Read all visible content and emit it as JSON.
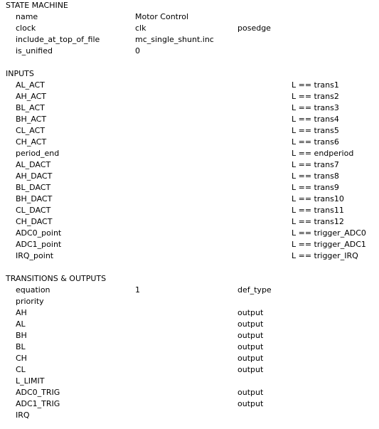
{
  "document": {
    "background_color": "#ffffff",
    "text_color": "#000000"
  },
  "sections": [
    {
      "id": "state-machine",
      "header": "STATE MACHINE",
      "rows": [
        {
          "label": "name",
          "value": "Motor Control",
          "extra": "",
          "condition": ""
        },
        {
          "label": "clock",
          "value": "clk",
          "extra": "posedge",
          "condition": ""
        },
        {
          "label": "include_at_top_of_file",
          "value": "mc_single_shunt.inc",
          "extra": "",
          "condition": ""
        },
        {
          "label": "is_unified",
          "value": "0",
          "extra": "",
          "condition": ""
        }
      ]
    },
    {
      "id": "inputs",
      "header": "INPUTS",
      "rows": [
        {
          "label": "AL_ACT",
          "value": "",
          "extra": "",
          "condition": "L == trans1"
        },
        {
          "label": "AH_ACT",
          "value": "",
          "extra": "",
          "condition": "L == trans2"
        },
        {
          "label": "BL_ACT",
          "value": "",
          "extra": "",
          "condition": "L == trans3"
        },
        {
          "label": "BH_ACT",
          "value": "",
          "extra": "",
          "condition": "L == trans4"
        },
        {
          "label": "CL_ACT",
          "value": "",
          "extra": "",
          "condition": "L == trans5"
        },
        {
          "label": "CH_ACT",
          "value": "",
          "extra": "",
          "condition": "L == trans6"
        },
        {
          "label": "period_end",
          "value": "",
          "extra": "",
          "condition": "L == endperiod"
        },
        {
          "label": "AL_DACT",
          "value": "",
          "extra": "",
          "condition": "L == trans7"
        },
        {
          "label": "AH_DACT",
          "value": "",
          "extra": "",
          "condition": "L == trans8"
        },
        {
          "label": "BL_DACT",
          "value": "",
          "extra": "",
          "condition": "L == trans9"
        },
        {
          "label": "BH_DACT",
          "value": "",
          "extra": "",
          "condition": "L == trans10"
        },
        {
          "label": "CL_DACT",
          "value": "",
          "extra": "",
          "condition": "L == trans11"
        },
        {
          "label": "CH_DACT",
          "value": "",
          "extra": "",
          "condition": "L == trans12"
        },
        {
          "label": "ADC0_point",
          "value": "",
          "extra": "",
          "condition": "L == trigger_ADC0"
        },
        {
          "label": "ADC1_point",
          "value": "",
          "extra": "",
          "condition": "L == trigger_ADC1"
        },
        {
          "label": "IRQ_point",
          "value": "",
          "extra": "",
          "condition": "L == trigger_IRQ"
        }
      ]
    },
    {
      "id": "transitions-outputs",
      "header": "TRANSITIONS & OUTPUTS",
      "rows": [
        {
          "label": "equation",
          "value": "1",
          "extra": "def_type",
          "condition": ""
        },
        {
          "label": "priority",
          "value": "",
          "extra": "",
          "condition": ""
        },
        {
          "label": "AH",
          "value": "",
          "extra": "output",
          "condition": ""
        },
        {
          "label": "AL",
          "value": "",
          "extra": "output",
          "condition": ""
        },
        {
          "label": "BH",
          "value": "",
          "extra": "output",
          "condition": ""
        },
        {
          "label": "BL",
          "value": "",
          "extra": "output",
          "condition": ""
        },
        {
          "label": "CH",
          "value": "",
          "extra": "output",
          "condition": ""
        },
        {
          "label": "CL",
          "value": "",
          "extra": "output",
          "condition": ""
        },
        {
          "label": "L_LIMIT",
          "value": "",
          "extra": "",
          "condition": ""
        },
        {
          "label": "ADC0_TRIG",
          "value": "",
          "extra": "output",
          "condition": ""
        },
        {
          "label": "ADC1_TRIG",
          "value": "",
          "extra": "output",
          "condition": ""
        },
        {
          "label": "IRQ",
          "value": "",
          "extra": "",
          "condition": ""
        }
      ]
    }
  ]
}
